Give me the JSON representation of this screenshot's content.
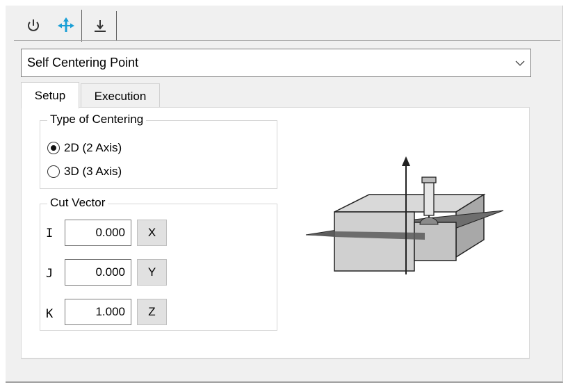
{
  "toolbar": {
    "tabs": [
      {
        "icon": "power-icon"
      },
      {
        "icon": "move-arrows-icon",
        "active": true,
        "color": "#1a9fd6"
      },
      {
        "icon": "probe-down-icon"
      }
    ]
  },
  "dropdown": {
    "value": "Self Centering Point"
  },
  "tabs": {
    "setup": "Setup",
    "execution": "Execution"
  },
  "centering": {
    "legend": "Type of Centering",
    "options": [
      {
        "label": "2D (2 Axis)",
        "selected": true
      },
      {
        "label": "3D (3 Axis)",
        "selected": false
      }
    ]
  },
  "cut_vector": {
    "legend": "Cut Vector",
    "rows": [
      {
        "label": "I",
        "value": "0.000",
        "button": "X"
      },
      {
        "label": "J",
        "value": "0.000",
        "button": "Y"
      },
      {
        "label": "K",
        "value": "1.000",
        "button": "Z"
      }
    ]
  },
  "illustration": {
    "icon": "self-centering-part-illustration"
  }
}
